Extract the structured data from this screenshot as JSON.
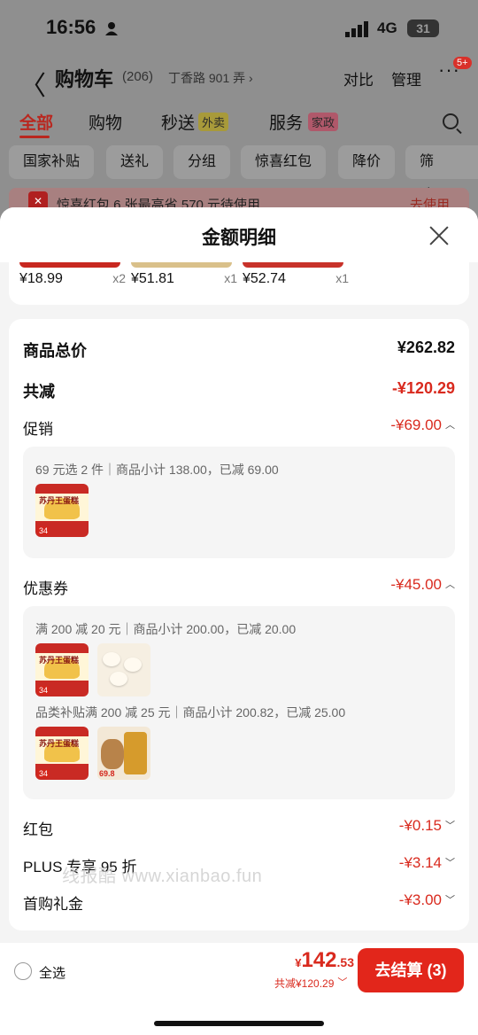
{
  "status": {
    "time": "16:56",
    "network": "4G",
    "battery": "31"
  },
  "nav": {
    "back": "〈",
    "title": "购物车",
    "count": "(206)",
    "address": "丁香路 901 弄 ›",
    "compare": "对比",
    "manage": "管理",
    "more": "···",
    "badge": "5+"
  },
  "tabs": [
    {
      "label": "全部"
    },
    {
      "label": "购物"
    },
    {
      "label": "秒送",
      "tag": "外卖"
    },
    {
      "label": "服务",
      "tag": "家政"
    }
  ],
  "chips": [
    "国家补贴",
    "送礼",
    "分组",
    "惊喜红包",
    "降价",
    "筛选"
  ],
  "red_packet_bar": {
    "text": "惊喜红包 6 张最高省 570 元待使用",
    "link": "去使用"
  },
  "sheet": {
    "title": "金额明细",
    "products": [
      {
        "price": "¥18.99",
        "qty": "x2"
      },
      {
        "price": "¥51.81",
        "qty": "x1"
      },
      {
        "price": "¥52.74",
        "qty": "x1"
      }
    ],
    "summary": {
      "total_label": "商品总价",
      "total_value": "¥262.82",
      "reduce_label": "共减",
      "reduce_value": "-¥120.29",
      "promo_label": "促销",
      "promo_value": "-¥69.00",
      "promo_detail": "69 元选 2 件｜商品小计 138.00，已减 69.00",
      "coupon_label": "优惠券",
      "coupon_value": "-¥45.00",
      "coupon_detail_1": "满 200 减 20 元｜商品小计 200.00，已减 20.00",
      "coupon_detail_2": "品类补贴满 200 减 25 元｜商品小计 200.82，已减 25.00",
      "redpacket_label": "红包",
      "redpacket_value": "-¥0.15",
      "plus_label": "PLUS 专享 95 折",
      "plus_value": "-¥3.14",
      "firstbuy_label": "首购礼金",
      "firstbuy_value": "-¥3.00"
    },
    "thumb_texts": {
      "cake_label": "苏丹王蛋糕",
      "cake_tag": "34",
      "nut_tag": "69.8"
    },
    "watermark": "线报酷 www.xianbao.fun"
  },
  "bottom": {
    "select_all": "全选",
    "currency": "¥",
    "total_int": "142",
    "total_dec": ".53",
    "saving": "共减¥120.29",
    "checkout": "去结算 (3)"
  }
}
